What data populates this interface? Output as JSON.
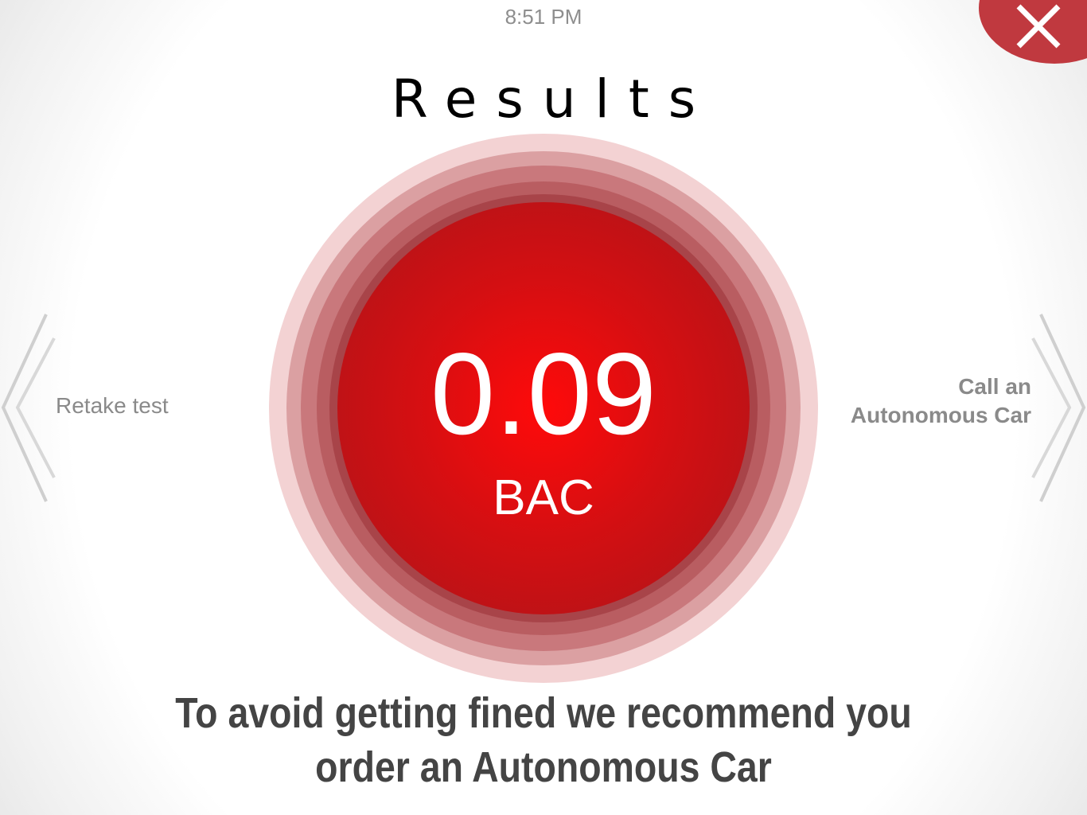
{
  "status_bar": {
    "time": "8:51 PM"
  },
  "header": {
    "title": "Results",
    "close_icon": "close-icon"
  },
  "result": {
    "value": "0.09",
    "unit": "BAC"
  },
  "navigation": {
    "left_label": "Retake test",
    "left_icon": "double-chevron-left-icon",
    "right_label_line1": "Call an",
    "right_label_line2": "Autonomous Car",
    "right_icon": "double-chevron-right-icon"
  },
  "message": {
    "line1": "To avoid getting fined we recommend you",
    "line2": "order an Autonomous Car"
  },
  "colors": {
    "accent_red": "#c0393f",
    "result_red": "#e10c10",
    "text_gray": "#444444"
  }
}
